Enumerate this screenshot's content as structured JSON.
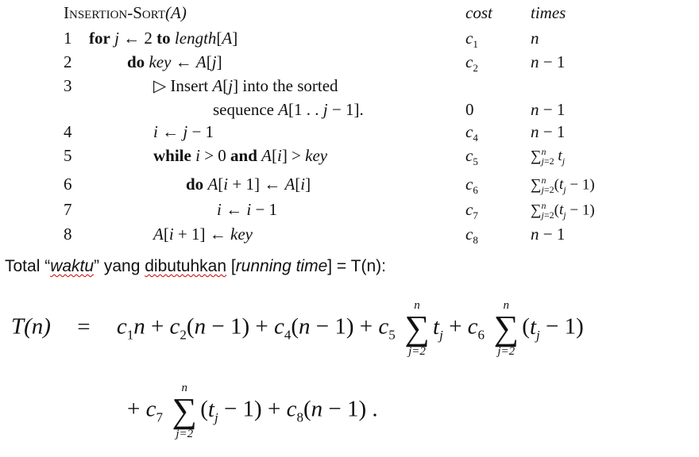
{
  "algorithm": {
    "title": "Insertion-Sort",
    "title_arg": "(A)",
    "col_cost": "cost",
    "col_times": "times",
    "lines": [
      {
        "num": "1",
        "code": "for j ← 2 to length[A]",
        "cost": "c1",
        "times": "n"
      },
      {
        "num": "2",
        "code": "do key ← A[j]",
        "cost": "c2",
        "times": "n − 1"
      },
      {
        "num": "3",
        "code": "▷ Insert A[j] into the sorted",
        "cost": "",
        "times": ""
      },
      {
        "num": "",
        "code": "sequence A[1 . . j − 1].",
        "cost": "0",
        "times": "n − 1"
      },
      {
        "num": "4",
        "code": "i ← j − 1",
        "cost": "c4",
        "times": "n − 1"
      },
      {
        "num": "5",
        "code": "while i > 0 and A[i] > key",
        "cost": "c5",
        "times": "∑ n j=2 t_j"
      },
      {
        "num": "6",
        "code": "do A[i + 1] ← A[i]",
        "cost": "c6",
        "times": "∑ n j=2 (t_j − 1)"
      },
      {
        "num": "7",
        "code": "i ← i − 1",
        "cost": "c7",
        "times": "∑ n j=2 (t_j − 1)"
      },
      {
        "num": "8",
        "code": "A[i + 1] ← key",
        "cost": "c8",
        "times": "n − 1"
      }
    ]
  },
  "total": {
    "prefix": "Total “",
    "waktu": "waktu",
    "mid": "” yang ",
    "dibutuhkan": "dibutuhkan",
    "bracket_open": " [",
    "running": "running time",
    "suffix": "] = T(n):"
  },
  "formula": {
    "lhs": "T(n)",
    "eq": "=",
    "line1": "c₁n + c₂(n − 1) + c₄(n − 1) + c₅",
    "term_tj": "t",
    "plus_c6": "+ c₆",
    "term_tj1": "(t",
    "close": " − 1)",
    "line2_start": "+ c₇",
    "line2_end": " − 1) + c₈(n − 1) .",
    "sum_top": "n",
    "sum_bottom": "j=2"
  }
}
